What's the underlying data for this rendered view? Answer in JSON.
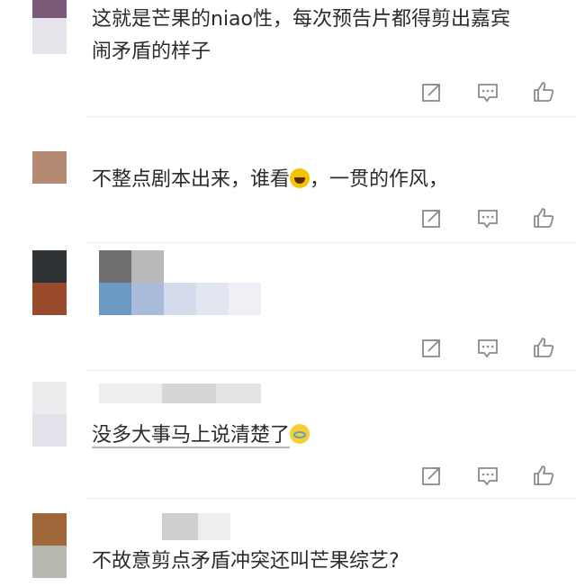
{
  "comments": [
    {
      "text_line1": "这就是芒果的niao性，每次预告片都得剪出嘉宾",
      "text_line2": "闹矛盾的样子",
      "avatar_colors": [
        "#7a5a78",
        "#e6e3ea"
      ]
    },
    {
      "text": "不整点剧本出来，谁看",
      "text_after_emoji": "，一贯的作风，",
      "emoji": "laughing-emoji",
      "avatar_colors": [
        "#b58a72"
      ]
    },
    {
      "text": "",
      "avatar_colors": [
        "#2f3336",
        "#9a4b2b"
      ],
      "blurred": true
    },
    {
      "text": "没多大事马上说清楚了",
      "emoji": "crying-laughing-emoji",
      "avatar_colors": [
        "#ececef",
        "#e2e2ea"
      ]
    },
    {
      "text": "不故意剪点矛盾冲突还叫芒果综艺?",
      "avatar_colors": [
        "#a0683a",
        "#b7b9b1"
      ]
    }
  ],
  "actions": {
    "share_icon": "share-icon",
    "reply_icon": "comment-icon",
    "like_icon": "thumbs-up-icon"
  },
  "colors": {
    "icon": "#8a8a8a",
    "text": "#2b2b2b",
    "divider": "#ececec"
  }
}
